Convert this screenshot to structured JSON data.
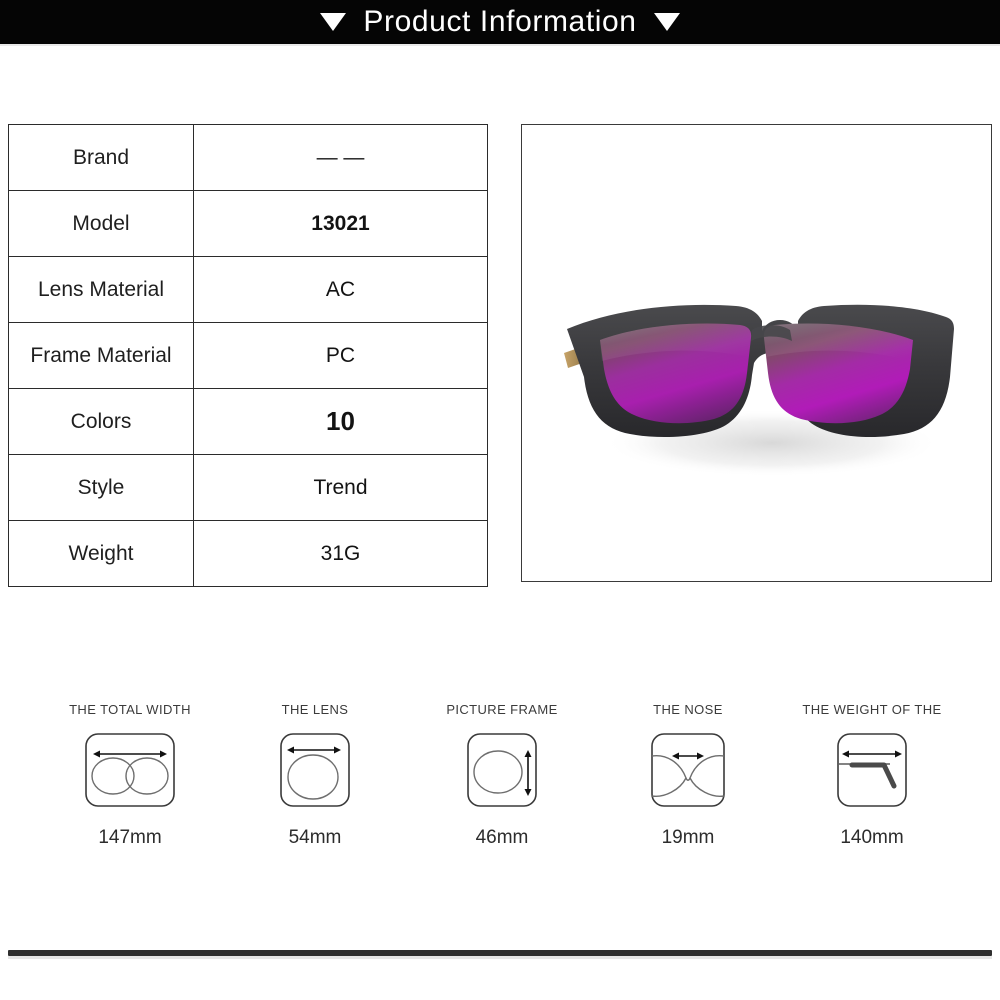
{
  "header": {
    "title": "Product Information",
    "left_marker": "▼",
    "right_marker": "▼",
    "background_color": "#050505",
    "text_color": "#ffffff"
  },
  "spec_table": {
    "rows": [
      {
        "label": "Brand",
        "value": "— —",
        "emphasis": false
      },
      {
        "label": "Model",
        "value": "13021",
        "emphasis": false,
        "bold": true
      },
      {
        "label": "Lens Material",
        "value": "AC",
        "emphasis": false
      },
      {
        "label": "Frame Material",
        "value": "PC",
        "emphasis": false
      },
      {
        "label": "Colors",
        "value": "10",
        "emphasis": true
      },
      {
        "label": "Style",
        "value": "Trend",
        "emphasis": false
      },
      {
        "label": "Weight",
        "value": "31G",
        "emphasis": false
      }
    ]
  },
  "product_image": {
    "alt": "black square frame sunglasses with purple mirrored lenses",
    "frame_color": "#3a3a3c",
    "lens_color_top": "#6b4a5e",
    "lens_color_mid": "#a01fb0",
    "lens_color_bottom": "#7d2a86",
    "background_color": "#ffffff",
    "border_color": "#3a3a3a"
  },
  "measurements": [
    {
      "caption": "THE TOTAL WIDTH",
      "value": "147mm",
      "icon": "total-width-icon",
      "arrow": "horizontal"
    },
    {
      "caption": "THE LENS",
      "value": "54mm",
      "icon": "lens-width-icon",
      "arrow": "horizontal"
    },
    {
      "caption": "PICTURE FRAME",
      "value": "46mm",
      "icon": "lens-height-icon",
      "arrow": "vertical"
    },
    {
      "caption": "THE NOSE",
      "value": "19mm",
      "icon": "bridge-width-icon",
      "arrow": "horizontal"
    },
    {
      "caption": "THE WEIGHT OF THE",
      "value": "140mm",
      "icon": "temple-length-icon",
      "arrow": "horizontal"
    }
  ]
}
